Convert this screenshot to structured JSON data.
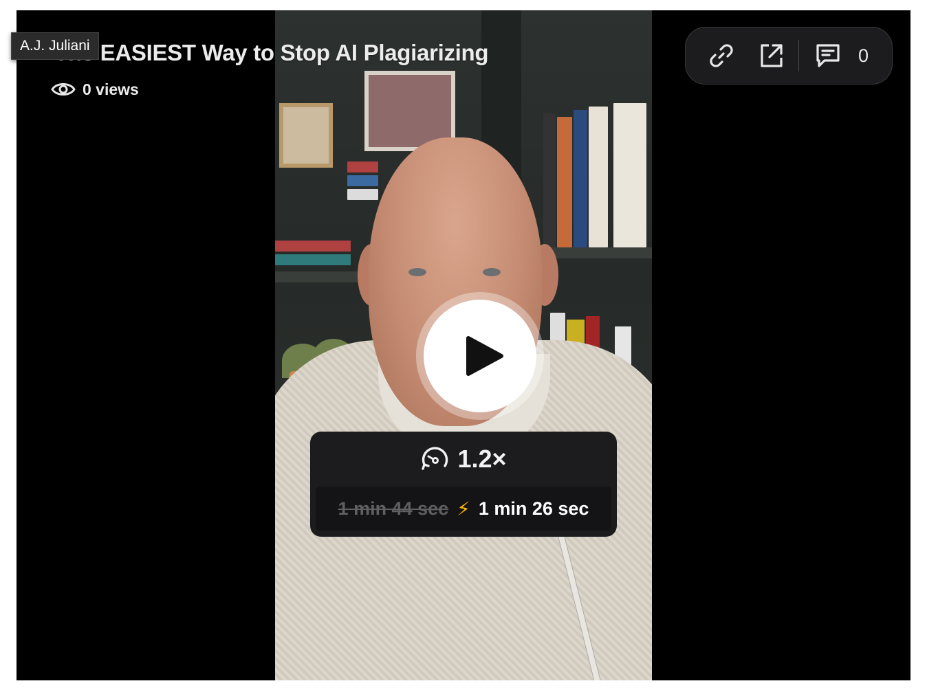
{
  "video": {
    "title": "The EASIEST Way to Stop AI Plagiarizing",
    "author_tooltip": "A.J. Juliani",
    "views_label": "0 views"
  },
  "actions": {
    "copy_link_icon": "link-icon",
    "share_icon": "external-share-icon",
    "comments_icon": "comment-icon",
    "comment_count": "0"
  },
  "player": {
    "play_icon": "play-icon",
    "speed_icon": "speedometer-icon",
    "speed_label": "1.2×",
    "original_duration": "1 min 44 sec",
    "bolt_icon": "⚡",
    "sped_up_duration": "1 min 26 sec"
  },
  "colors": {
    "player_bg": "#000000",
    "card_bg": "#1c1c1e",
    "bolt": "#f4b400"
  }
}
